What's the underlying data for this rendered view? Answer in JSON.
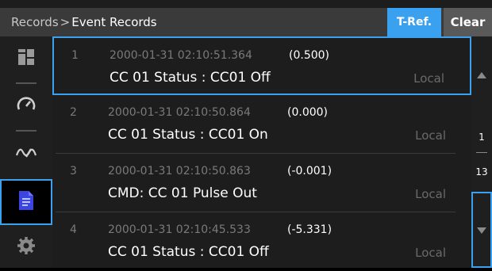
{
  "header": {
    "breadcrumb_root": "Records",
    "breadcrumb_sep": ">",
    "breadcrumb_current": "Event Records",
    "tref_label": "T-Ref.",
    "clear_label": "Clear"
  },
  "sidebar": {
    "items": [
      {
        "icon": "dashboard-icon"
      },
      {
        "icon": "gauge-icon"
      },
      {
        "icon": "waveform-icon"
      },
      {
        "icon": "records-icon",
        "active": true
      },
      {
        "icon": "settings-gear-icon"
      }
    ]
  },
  "records": [
    {
      "num": "1",
      "timestamp": "2000-01-31 02:10:51.364",
      "delta": "(0.500)",
      "message": "CC 01 Status : CC01 Off",
      "source": "Local"
    },
    {
      "num": "2",
      "timestamp": "2000-01-31 02:10:50.864",
      "delta": "(0.000)",
      "message": "CC 01 Status : CC01 On",
      "source": "Local"
    },
    {
      "num": "3",
      "timestamp": "2000-01-31 02:10:50.863",
      "delta": "(-0.001)",
      "message": "CMD: CC 01 Pulse Out",
      "source": "Local"
    },
    {
      "num": "4",
      "timestamp": "2000-01-31 02:10:45.533",
      "delta": "(-5.331)",
      "message": "CC 01 Status : CC01 Off",
      "source": "Local"
    }
  ],
  "pager": {
    "current": "1",
    "total": "13"
  },
  "colors": {
    "accent": "#3aa0f0",
    "background": "#1d1d1d",
    "header": "#3a3a3a"
  }
}
